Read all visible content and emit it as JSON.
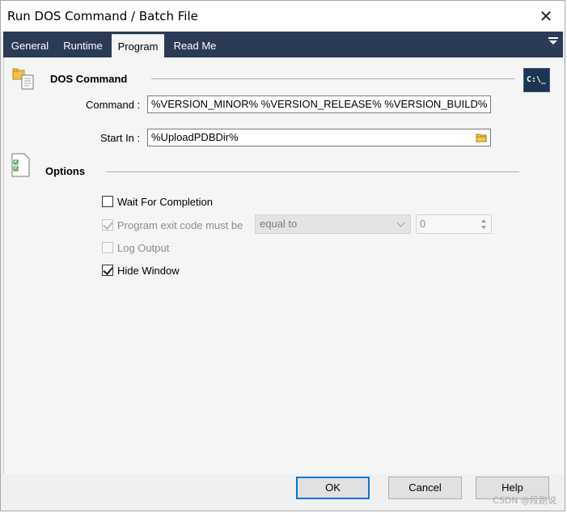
{
  "window": {
    "title": "Run DOS Command / Batch File",
    "close_glyph": "✕"
  },
  "tabs": [
    {
      "label": "General",
      "active": false
    },
    {
      "label": "Runtime",
      "active": false
    },
    {
      "label": "Program",
      "active": true
    },
    {
      "label": "Read Me",
      "active": false
    }
  ],
  "dos_command": {
    "section_label": "DOS Command",
    "command_label": "Command :",
    "command_value": "%VERSION_MINOR% %VERSION_RELEASE% %VERSION_BUILD%",
    "start_in_label": "Start In :",
    "start_in_value": "%UploadPDBDir%",
    "console_icon_text": "C:\\_"
  },
  "options": {
    "section_label": "Options",
    "wait_for_completion": {
      "label": "Wait For Completion",
      "checked": false,
      "enabled": true
    },
    "exit_code": {
      "label": "Program exit code must be",
      "checked": true,
      "enabled": false
    },
    "comparison": {
      "value": "equal to",
      "enabled": false
    },
    "exit_code_value": {
      "value": "0",
      "enabled": false
    },
    "log_output": {
      "label": "Log Output",
      "checked": false,
      "enabled": false
    },
    "hide_window": {
      "label": "Hide Window",
      "checked": true,
      "enabled": true
    }
  },
  "buttons": {
    "ok": "OK",
    "cancel": "Cancel",
    "help": "Help"
  },
  "watermark": "CSDN @段跑说",
  "colors": {
    "tab_bar": "#2b3a55",
    "default_button_border": "#0078d7"
  }
}
